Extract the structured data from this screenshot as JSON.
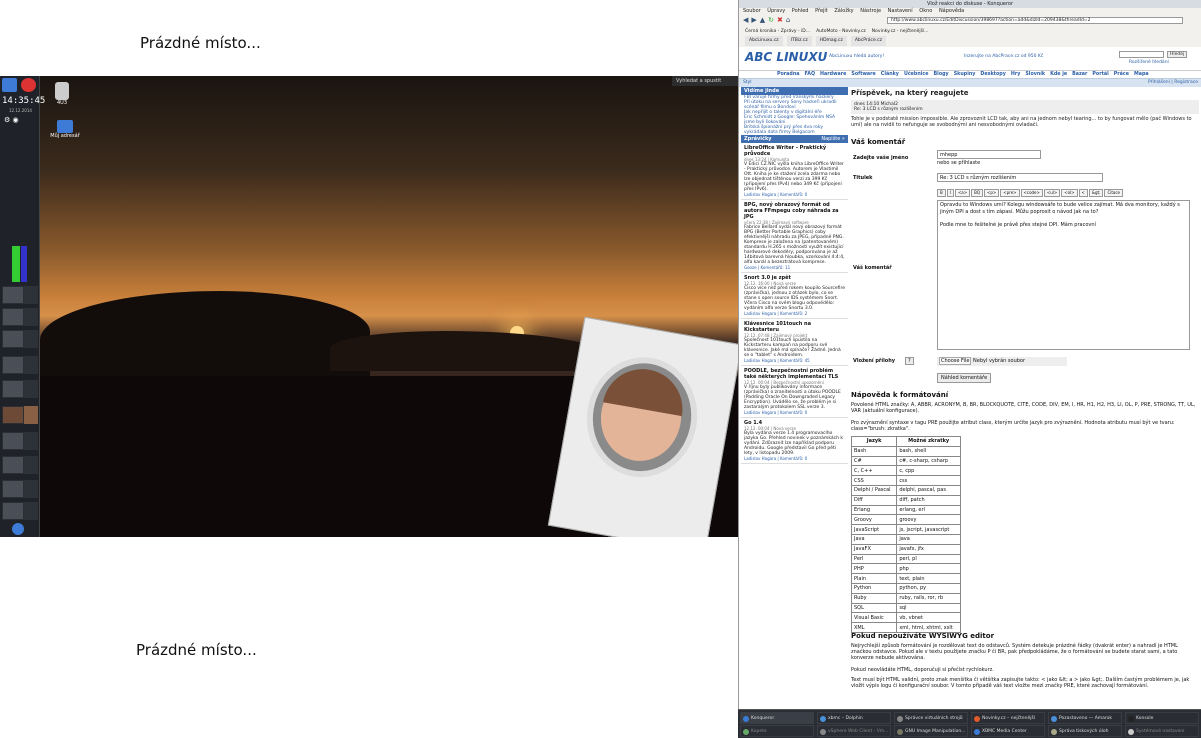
{
  "labels": {
    "top": "Prázdné místo...",
    "bottom": "Prázdné místo..."
  },
  "desktop": {
    "clock": "14:35:45",
    "date": "12.12.2014",
    "search": "Vyhledat a spustit",
    "icons": [
      "4U3",
      "Můj adresář"
    ]
  },
  "browser": {
    "title": "Vlož reakci do diskuse - Konqueror",
    "menu": [
      "Soubor",
      "Úpravy",
      "Pohled",
      "Přejít",
      "Záložky",
      "Nástroje",
      "Nastavení",
      "Okno",
      "Nápověda"
    ],
    "url": "http://www.abclinuxu.cz/EditDiscussion/398697?action=add&dizId=209438&threadId=2",
    "bookmarks": [
      "Černá kronika - Zprávy - iD...",
      "AutoMoto - Novinky.cz",
      "Novinky.cz - nejčtenější..."
    ],
    "tabs": [
      "AbcLinuxu.cz",
      "ITBiz.cz",
      "HDmag.cz",
      "AbcPráce.cz"
    ]
  },
  "site": {
    "logo": "ABC LINUXU",
    "head_left": "AbcLinuxu hledá autory!",
    "head_mid": "Inzerujte na AbcPrace.cz od 950 Kč",
    "head_right": "Hledej",
    "head_links": "Rozšířené hledání",
    "nav": [
      "Poradna",
      "FAQ",
      "Hardware",
      "Software",
      "Články",
      "Učebnice",
      "Blogy",
      "Skupiny",
      "Desktopy",
      "Hry",
      "Slovník",
      "Kde je",
      "Bazar",
      "Portál",
      "Práce",
      "Mapa"
    ],
    "styl": "Styl",
    "login": "Přihlášení | Registrace",
    "sidebar": {
      "vidame": "Vidíme jinde",
      "links": [
        "FBI varuje firmy před íránskými hackery",
        "Při útoku na servery Sony hackeři ukradli scénář filmu o Bondovi",
        "Jak nepřijít o talenty v digitální éře",
        "Eric Schmidt z Google: Špehováním NSA jsme byli šokováni",
        "Britská špionážní prý přes dva roky vykrádala data firmy Belgacom"
      ],
      "zpravicky": "Zprávičky",
      "napiste": "Napište »",
      "news": [
        {
          "title": "LibreOffice Writer - Praktický průvodce",
          "meta": "dnes 13:24 | Komunita",
          "body": "V Edici CZ.NIC vyšla kniha LibreOffice Writer - Praktický průvodce. Autorem je Vlastimil Ott. Kniha je ke stažení zcela zdarma nebo lze objednat tištěnou verzi za 399 Kč (připojení přes IPv4) nebo 349 Kč (připojení přes IPv6).",
          "foot": "Ladislav Hagara | Komentářů: 0"
        },
        {
          "title": "BPG, nový obrazový formát od autora FFmpegu coby náhrada za JPG",
          "meta": "včera 22:38 | Zajímavý software",
          "body": "Fabrice Bellard vydal nový obrazový formát BPG (Better Portable Graphics) coby efektivnější náhradu za JPEG, případně PNG. Komprese je založena na (patentovaném) standardu H.265 s možností využít existující hardwarové dekodéry, podporována je až 14bitová barevná hloubka, vzorkování 4:4:4, alfa kanál a bezeztrátová komprese.",
          "foot": "Gooze | Komentářů: 11"
        },
        {
          "title": "Snort 3.0 je zpět",
          "meta": "12.12. 16:00 | Nová verze",
          "body": "Cisco více než před rokem koupilo Sourcefire (zprávička), jednou z otázek bylo, co se stane s open source IDS systémem Snort. Včera Cisco na svém blogu odpovědělo: vydáním alfa verze Snortu 3.0.",
          "foot": "Ladislav Hagara | Komentářů: 2"
        },
        {
          "title": "Klávesnice 101touch na Kickstarteru",
          "meta": "12.12. 07:48 | Zajímavý projekt",
          "body": "Společnost 101touch spustila na Kickstarteru kampaň na podporu své klávesnice. Jaké má spínače? Žádné. Jedná se o \"tablet\" s Androidem.",
          "foot": "Ladislav Hagara | Komentářů: 45"
        },
        {
          "title": "POODLE, bezpečnostní problém také některých implementací TLS",
          "meta": "12.12. 00:04 | Bezpečnostní upozornění",
          "body": "V říjnu byly publikovány informace (zprávička) o zranitelnosti a útoku POODLE (Padding Oracle On Downgraded Legacy Encryption). Uvádělo se, že problém je si zastaralým protokolem SSL verze 3.",
          "foot": "Ladislav Hagara | Komentářů: 0"
        },
        {
          "title": "Go 1.4",
          "meta": "12.12. 00:04 | Nová verze",
          "body": "Byla vydána verze 1.4 programovacího jazyka Go. Přehled novinek v poznámkách k vydání. Zdůraznit lze například podporu Androidu. Google představil Go před pěti lety, v listopadu 2009.",
          "foot": "Ladislav Hagara | Komentářů: 0"
        }
      ]
    },
    "main": {
      "heading": "Příspěvek, na který reagujete",
      "quote_meta": "dnes 14:10 Michal2",
      "quote_title": "Re: 3 LCD s různým rozlišením",
      "quote_body": "Tohle je v podstatě mission impossible. Ale zprovoznit LCD tak, aby ani na jednom nebyl tearing... to by fungovat mělo (pač Windows to umí) ale na nvidii to nefunguje se svobodnými ani nesvobodnými ovladači.",
      "form_title": "Váš komentář",
      "name_label": "Zadejte vaše jméno",
      "name_value": "mhepp",
      "or_login": "nebo se přihlaste",
      "title_label": "Titulek",
      "title_value": "Re: 3 LCD s různým rozlišením",
      "toolbar": [
        "B",
        "I",
        "<a>",
        "BQ",
        "<p>",
        "<pre>",
        "<code>",
        "<ul>",
        "<ol>",
        "<",
        "&gt;",
        "Citace"
      ],
      "comment_label": "Váš komentář",
      "comment_text": "Opravdu to Windows umí? Kolegu windowsáře to bude velice zajímat. Má dva monitory, každý s jiným DPI a dost s tím zápasí. Můžu poprosit o návod jak na to?\n\nPodle mne to řešitelné je právě přes stejné DPI. Mám pracovní",
      "attach_label": "Vložení přílohy",
      "help_q": "?",
      "choose_file": "Choose File",
      "no_file": "Nebyl vybrán soubor",
      "preview_btn": "Náhled komentáře",
      "help_title": "Nápověda k formátování",
      "help_p1": "Povolené HTML značky: A, ABBR, ACRONYM, B, BR, BLOCKQUOTE, CITE, CODE, DIV, EM, I, HR, H1, H2, H3, LI, OL, P, PRE, STRONG, TT, UL, VAR (aktuální konfigurace).",
      "help_p2": "Pro zvýraznění syntaxe v tagu PRE použijte atribut class, kterým určíte jazyk pro zvýraznění. Hodnota atributu musí být ve tvaru: class=\"brush: zkratka\".",
      "table_head": [
        "Jazyk",
        "Možné zkratky"
      ],
      "table": [
        [
          "Bash",
          "bash, shell"
        ],
        [
          "C#",
          "c#, c-sharp, csharp"
        ],
        [
          "C, C++",
          "c, cpp"
        ],
        [
          "CSS",
          "css"
        ],
        [
          "Delphi / Pascal",
          "delphi, pascal, pas"
        ],
        [
          "Diff",
          "diff, patch"
        ],
        [
          "Erlang",
          "erlang, erl"
        ],
        [
          "Groovy",
          "groovy"
        ],
        [
          "JavaScript",
          "js, jscript, javascript"
        ],
        [
          "Java",
          "java"
        ],
        [
          "JavaFX",
          "javafx, jfx"
        ],
        [
          "Perl",
          "perl, pl"
        ],
        [
          "PHP",
          "php"
        ],
        [
          "Plain",
          "text, plain"
        ],
        [
          "Python",
          "python, py"
        ],
        [
          "Ruby",
          "ruby, rails, ror, rb"
        ],
        [
          "SQL",
          "sql"
        ],
        [
          "Visual Basic",
          "vb, vbnet"
        ],
        [
          "XML",
          "xml, html, xhtml, xslt"
        ]
      ],
      "wysiwyg_title": "Pokud nepoužíváte WYSIWYG editor",
      "wysiwyg_p1": "Nejrychlejší způsob formátování je rozdělovat text do odstavců. Systém detekuje prázdné řádky (dvakrát enter) a nahradí je HTML značkou odstavce. Pokud ale v textu použijete značku P či BR, pak předpokládáme, že o formátování se budete starat sami, a tato konverze nebude aktivována.",
      "wysiwyg_p2": "Pokud neovládáte HTML, doporučuji si přečíst rychlokurz.",
      "wysiwyg_p3": "Text musí být HTML validní, proto znak menšítka či většítka zapisujte takto: < jako &lt; a > jako &gt;. Dalším častým problémem je, jak vložit výpis logu či konfigurační soubor. V tomto případě váš text vložte mezi značky PRE, které zachovají formátování."
    }
  },
  "taskbar": [
    {
      "label": "Konqueror",
      "color": "#3a7bd5",
      "active": true
    },
    {
      "label": "xbmc – Dolphin",
      "color": "#4a90d9",
      "active": true
    },
    {
      "label": "Správce virtuálních strojů",
      "color": "#888",
      "active": true
    },
    {
      "label": "Novinky.cz – nejčtenější",
      "color": "#e05a2b",
      "active": true
    },
    {
      "label": "Pozastaveno — Amarok",
      "color": "#4a90d9",
      "active": true
    },
    {
      "label": "Konsole",
      "color": "#222",
      "active": true
    },
    {
      "label": "Kopete",
      "color": "#6a6",
      "active": false
    },
    {
      "label": "vSphere Web Client - Vm...",
      "color": "#888",
      "active": false
    },
    {
      "label": "GNU Image Manipulation...",
      "color": "#776",
      "active": false
    },
    {
      "label": "XBMC Media Center",
      "color": "#3a7bd5",
      "active": false
    },
    {
      "label": "Správa tiskových úloh",
      "color": "#aa8",
      "active": false
    },
    {
      "label": "Systémové nastavení",
      "color": "#ccc",
      "active": false
    }
  ]
}
